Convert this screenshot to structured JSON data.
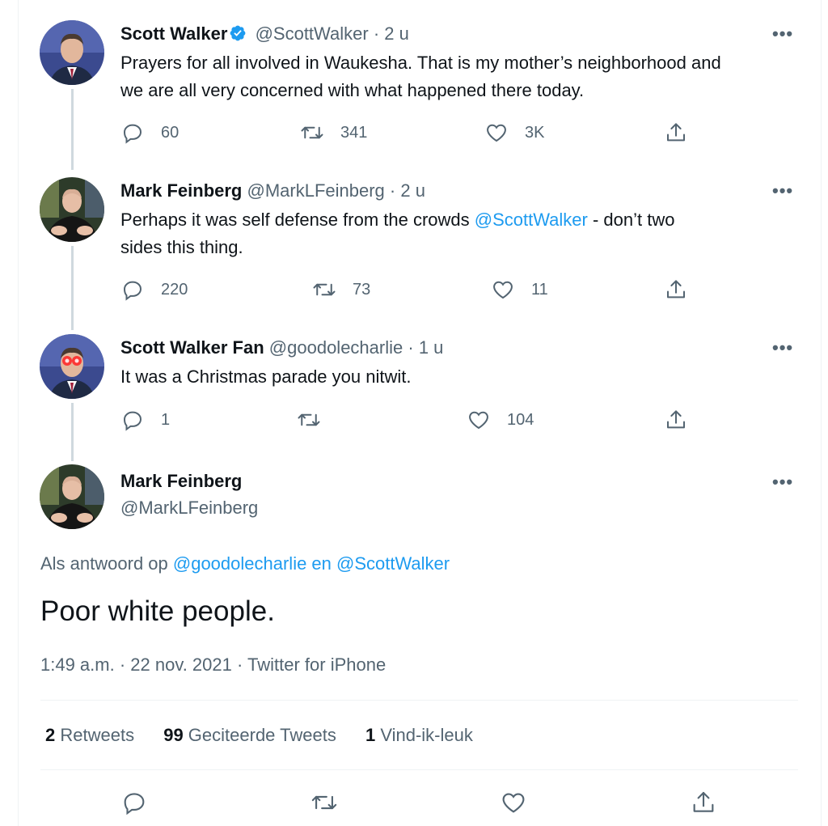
{
  "thread": [
    {
      "name": "Scott Walker",
      "verified": true,
      "handle": "@ScottWalker",
      "sep": "·",
      "time": "2 u",
      "more": "•••",
      "text_lines": [
        "Prayers for all involved in Waukesha. That is my mother’s neighborhood and",
        "we are all very concerned with what happened there today."
      ],
      "replies": "60",
      "retweets": "341",
      "likes": "3K"
    },
    {
      "name": "Mark Feinberg",
      "handle": "@MarkLFeinberg",
      "sep": "·",
      "time": "2 u",
      "more": "•••",
      "text_before": "Perhaps it was self defense from the crowds ",
      "text_mention": "@ScottWalker",
      "text_after": " - don’t two",
      "text_line2": "sides this thing.",
      "replies": "220",
      "retweets": "73",
      "likes": "11"
    },
    {
      "name": "Scott Walker Fan",
      "handle": "@goodolecharlie",
      "sep": "·",
      "time": "1 u",
      "more": "•••",
      "text": "It was a Christmas parade you nitwit.",
      "replies": "1",
      "retweets": "",
      "likes": "104"
    }
  ],
  "main": {
    "name": "Mark Feinberg",
    "handle": "@MarkLFeinberg",
    "more": "•••",
    "reply_prefix": "Als antwoord op ",
    "reply_mention": "@goodolecharlie en @ScottWalker",
    "text": "Poor white people.",
    "meta": "1:49 a.m. · 22 nov. 2021 · Twitter for iPhone",
    "stats": [
      {
        "num": "2",
        "label": " Retweets"
      },
      {
        "num": "99",
        "label": " Geciteerde Tweets"
      },
      {
        "num": "1",
        "label": " Vind-ik-leuk"
      }
    ]
  },
  "icons": {
    "reply": "reply-icon",
    "retweet": "retweet-icon",
    "like": "heart-icon",
    "share": "share-icon",
    "verified": "verified-badge-icon"
  },
  "colors": {
    "link": "#1d9bf0",
    "secondary": "#536471",
    "text": "#0f1419",
    "thread_line": "#cfd9de"
  }
}
